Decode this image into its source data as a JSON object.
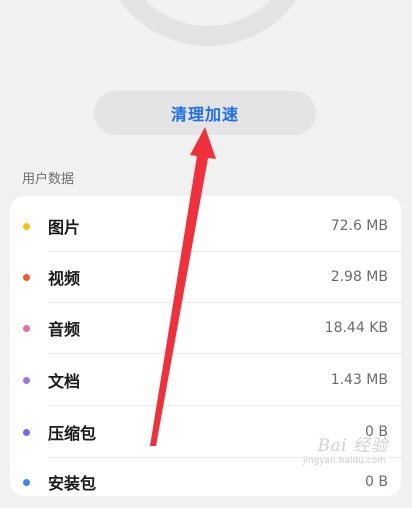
{
  "clean_button": {
    "label": "清理加速"
  },
  "section": {
    "title": "用户数据"
  },
  "items": [
    {
      "label": "图片",
      "size": "72.6 MB",
      "color": "#f5c211",
      "icon": "dot-yellow"
    },
    {
      "label": "视频",
      "size": "2.98 MB",
      "color": "#f05a2a",
      "icon": "dot-orange"
    },
    {
      "label": "音频",
      "size": "18.44 KB",
      "color": "#f06aa6",
      "icon": "dot-pink"
    },
    {
      "label": "文档",
      "size": "1.43 MB",
      "color": "#a070e8",
      "icon": "dot-purple"
    },
    {
      "label": "压缩包",
      "size": "0 B",
      "color": "#6f6af0",
      "icon": "dot-indigo"
    },
    {
      "label": "安装包",
      "size": "0 B",
      "color": "#3a86f0",
      "icon": "dot-blue"
    }
  ],
  "watermark": {
    "text": "Bai 经验",
    "sub": "jingyan.baidu.com"
  },
  "annotation": {
    "color": "#f0303a"
  }
}
